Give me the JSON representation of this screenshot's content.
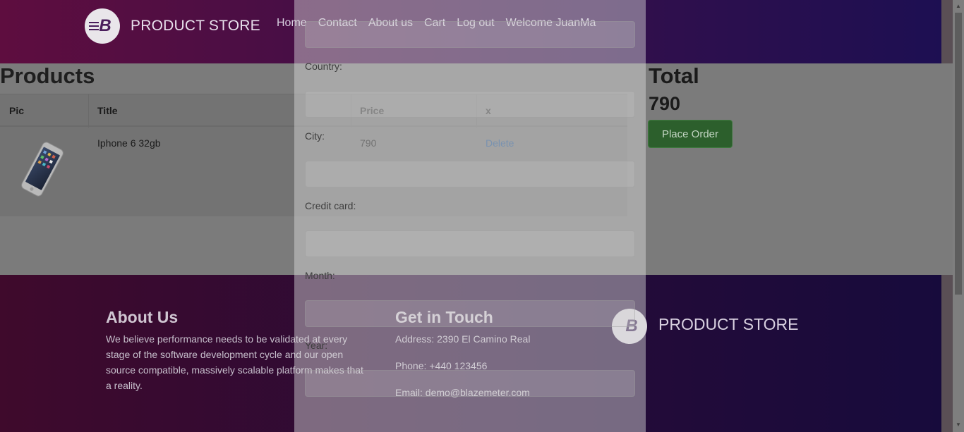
{
  "navbar": {
    "brand": "PRODUCT STORE",
    "logo_letter": "B",
    "links": [
      "Home",
      "Contact",
      "About us",
      "Cart",
      "Log out",
      "Welcome JuanMa"
    ]
  },
  "cart": {
    "title": "Products",
    "columns": [
      "Pic",
      "Title",
      "Price",
      "x"
    ],
    "rows": [
      {
        "title": "Iphone 6 32gb",
        "price": "790",
        "action": "Delete"
      }
    ]
  },
  "total": {
    "label": "Total",
    "value": "790",
    "place_order": "Place Order"
  },
  "order_form": {
    "fields": [
      "Country:",
      "City:",
      "Credit card:",
      "Month:",
      "Year:"
    ]
  },
  "footer": {
    "about_title": "About Us",
    "about_text": "We believe performance needs to be validated at every stage of the software development cycle and our open source compatible, massively scalable platform makes that a reality.",
    "contact_title": "Get in Touch",
    "address": "Address: 2390 El Camino Real",
    "phone": "Phone: +440 123456",
    "email": "Email: demo@blazemeter.com",
    "brand": "PRODUCT STORE"
  }
}
